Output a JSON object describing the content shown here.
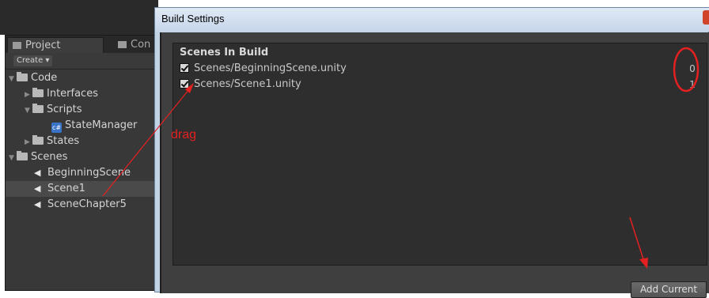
{
  "project_panel": {
    "tabs": [
      {
        "label": "Project",
        "icon": "folder-tab-icon"
      },
      {
        "label": "Con",
        "icon": "console-tab-icon"
      }
    ],
    "create_button": "Create ▾",
    "tree": [
      {
        "label": "Code",
        "type": "folder",
        "expanded": true
      },
      {
        "label": "Interfaces",
        "type": "folder",
        "expanded": false
      },
      {
        "label": "Scripts",
        "type": "folder",
        "expanded": true
      },
      {
        "label": "StateManager",
        "type": "csharp-script"
      },
      {
        "label": "States",
        "type": "folder",
        "expanded": false
      },
      {
        "label": "Scenes",
        "type": "folder",
        "expanded": true
      },
      {
        "label": "BeginningScene",
        "type": "unity-scene"
      },
      {
        "label": "Scene1",
        "type": "unity-scene",
        "selected": true
      },
      {
        "label": "SceneChapter5",
        "type": "unity-scene"
      }
    ]
  },
  "build_window": {
    "title": "Build Settings",
    "scenes_header": "Scenes In Build",
    "scenes": [
      {
        "path": "Scenes/BeginningScene.unity",
        "checked": true,
        "index": "0"
      },
      {
        "path": "Scenes/Scene1.unity",
        "checked": true,
        "index": "1"
      }
    ],
    "add_current_button": "Add Current"
  },
  "annotations": {
    "drag_label": "drag",
    "color": "#e42020"
  }
}
